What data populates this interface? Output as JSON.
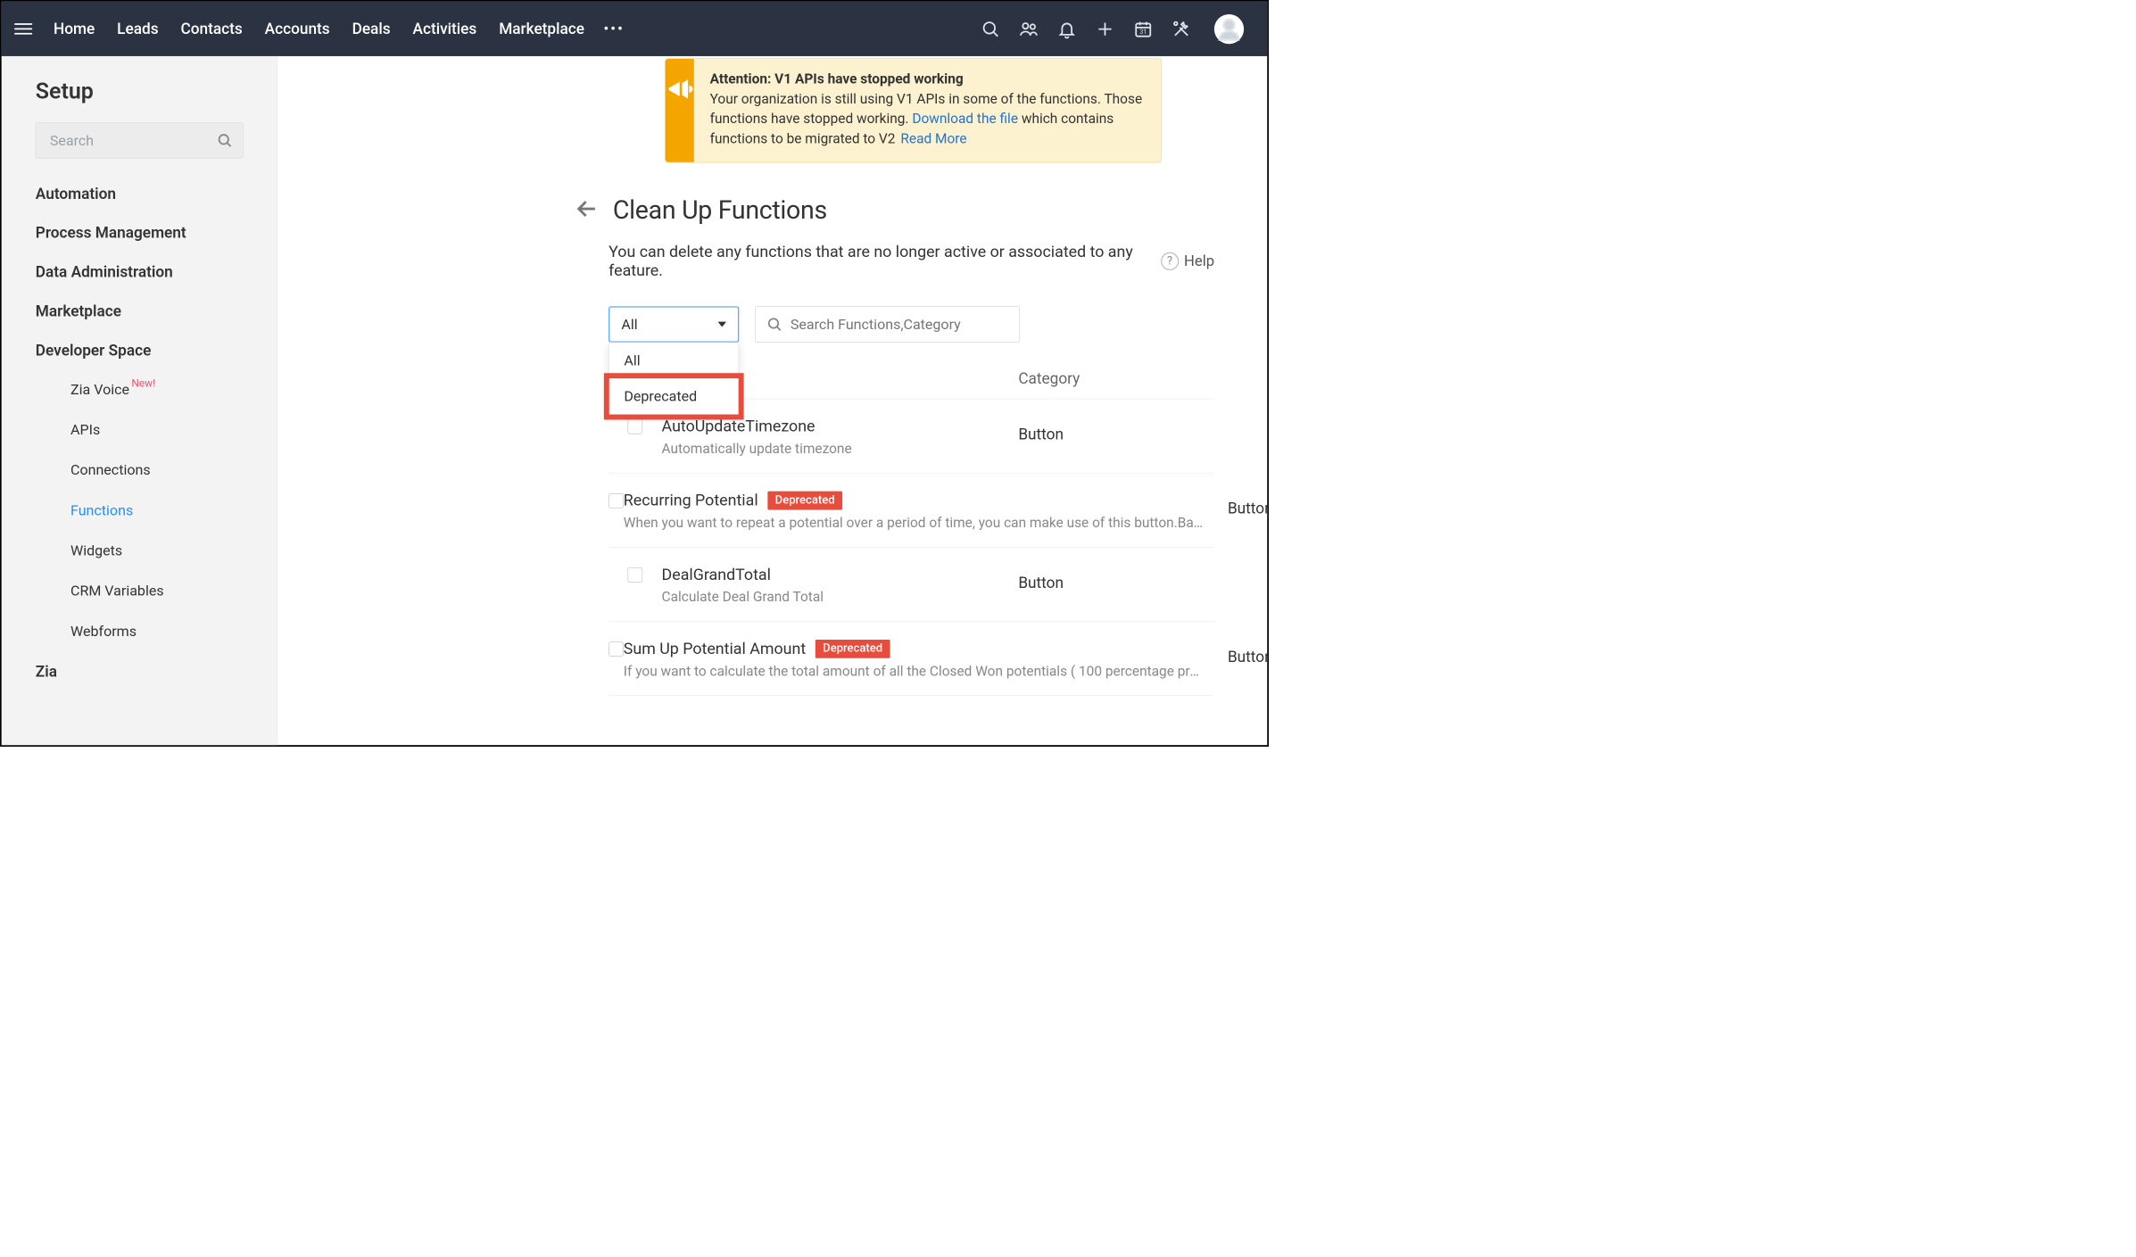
{
  "nav": {
    "items": [
      "Home",
      "Leads",
      "Contacts",
      "Accounts",
      "Deals",
      "Activities",
      "Marketplace"
    ]
  },
  "sidebar": {
    "title": "Setup",
    "search_placeholder": "Search",
    "groups": [
      "Automation",
      "Process Management",
      "Data Administration",
      "Marketplace",
      "Developer Space"
    ],
    "devspace": {
      "items": [
        "Zia Voice",
        "APIs",
        "Connections",
        "Functions",
        "Widgets",
        "CRM Variables",
        "Webforms"
      ],
      "new_label": "New!",
      "active": "Functions"
    },
    "last_group": "Zia"
  },
  "alert": {
    "title": "Attention: V1 APIs have stopped working",
    "text1": "Your organization is still using V1 APIs in some of the functions. Those functions have stopped working. ",
    "download": "Download the file",
    "text2": " which contains functions to be migrated to V2",
    "readmore": "Read More"
  },
  "page": {
    "title": "Clean Up Functions",
    "subtitle": "You can delete any functions that are no longer active or associated to any feature.",
    "help": "Help"
  },
  "filter": {
    "selected": "All",
    "options": [
      "All",
      "Deprecated"
    ],
    "search_placeholder": "Search Functions,Category"
  },
  "table": {
    "header_category": "Category",
    "deprecated_label": "Deprecated",
    "rows": [
      {
        "name": "AutoUpdateTimezone",
        "desc": "Automatically update timezone",
        "category": "Button",
        "deprecated": false
      },
      {
        "name": "Recurring Potential",
        "desc": "When you want to repeat a potential over a period of time, you can make use of this button.Based on y...",
        "category": "Button",
        "deprecated": true
      },
      {
        "name": "DealGrandTotal",
        "desc": "Calculate Deal Grand Total",
        "category": "Button",
        "deprecated": false
      },
      {
        "name": "Sum Up Potential Amount",
        "desc": "If you want to calculate the total amount of all the Closed Won potentials ( 100 percentage probability ) ...",
        "category": "Button",
        "deprecated": true
      }
    ]
  }
}
